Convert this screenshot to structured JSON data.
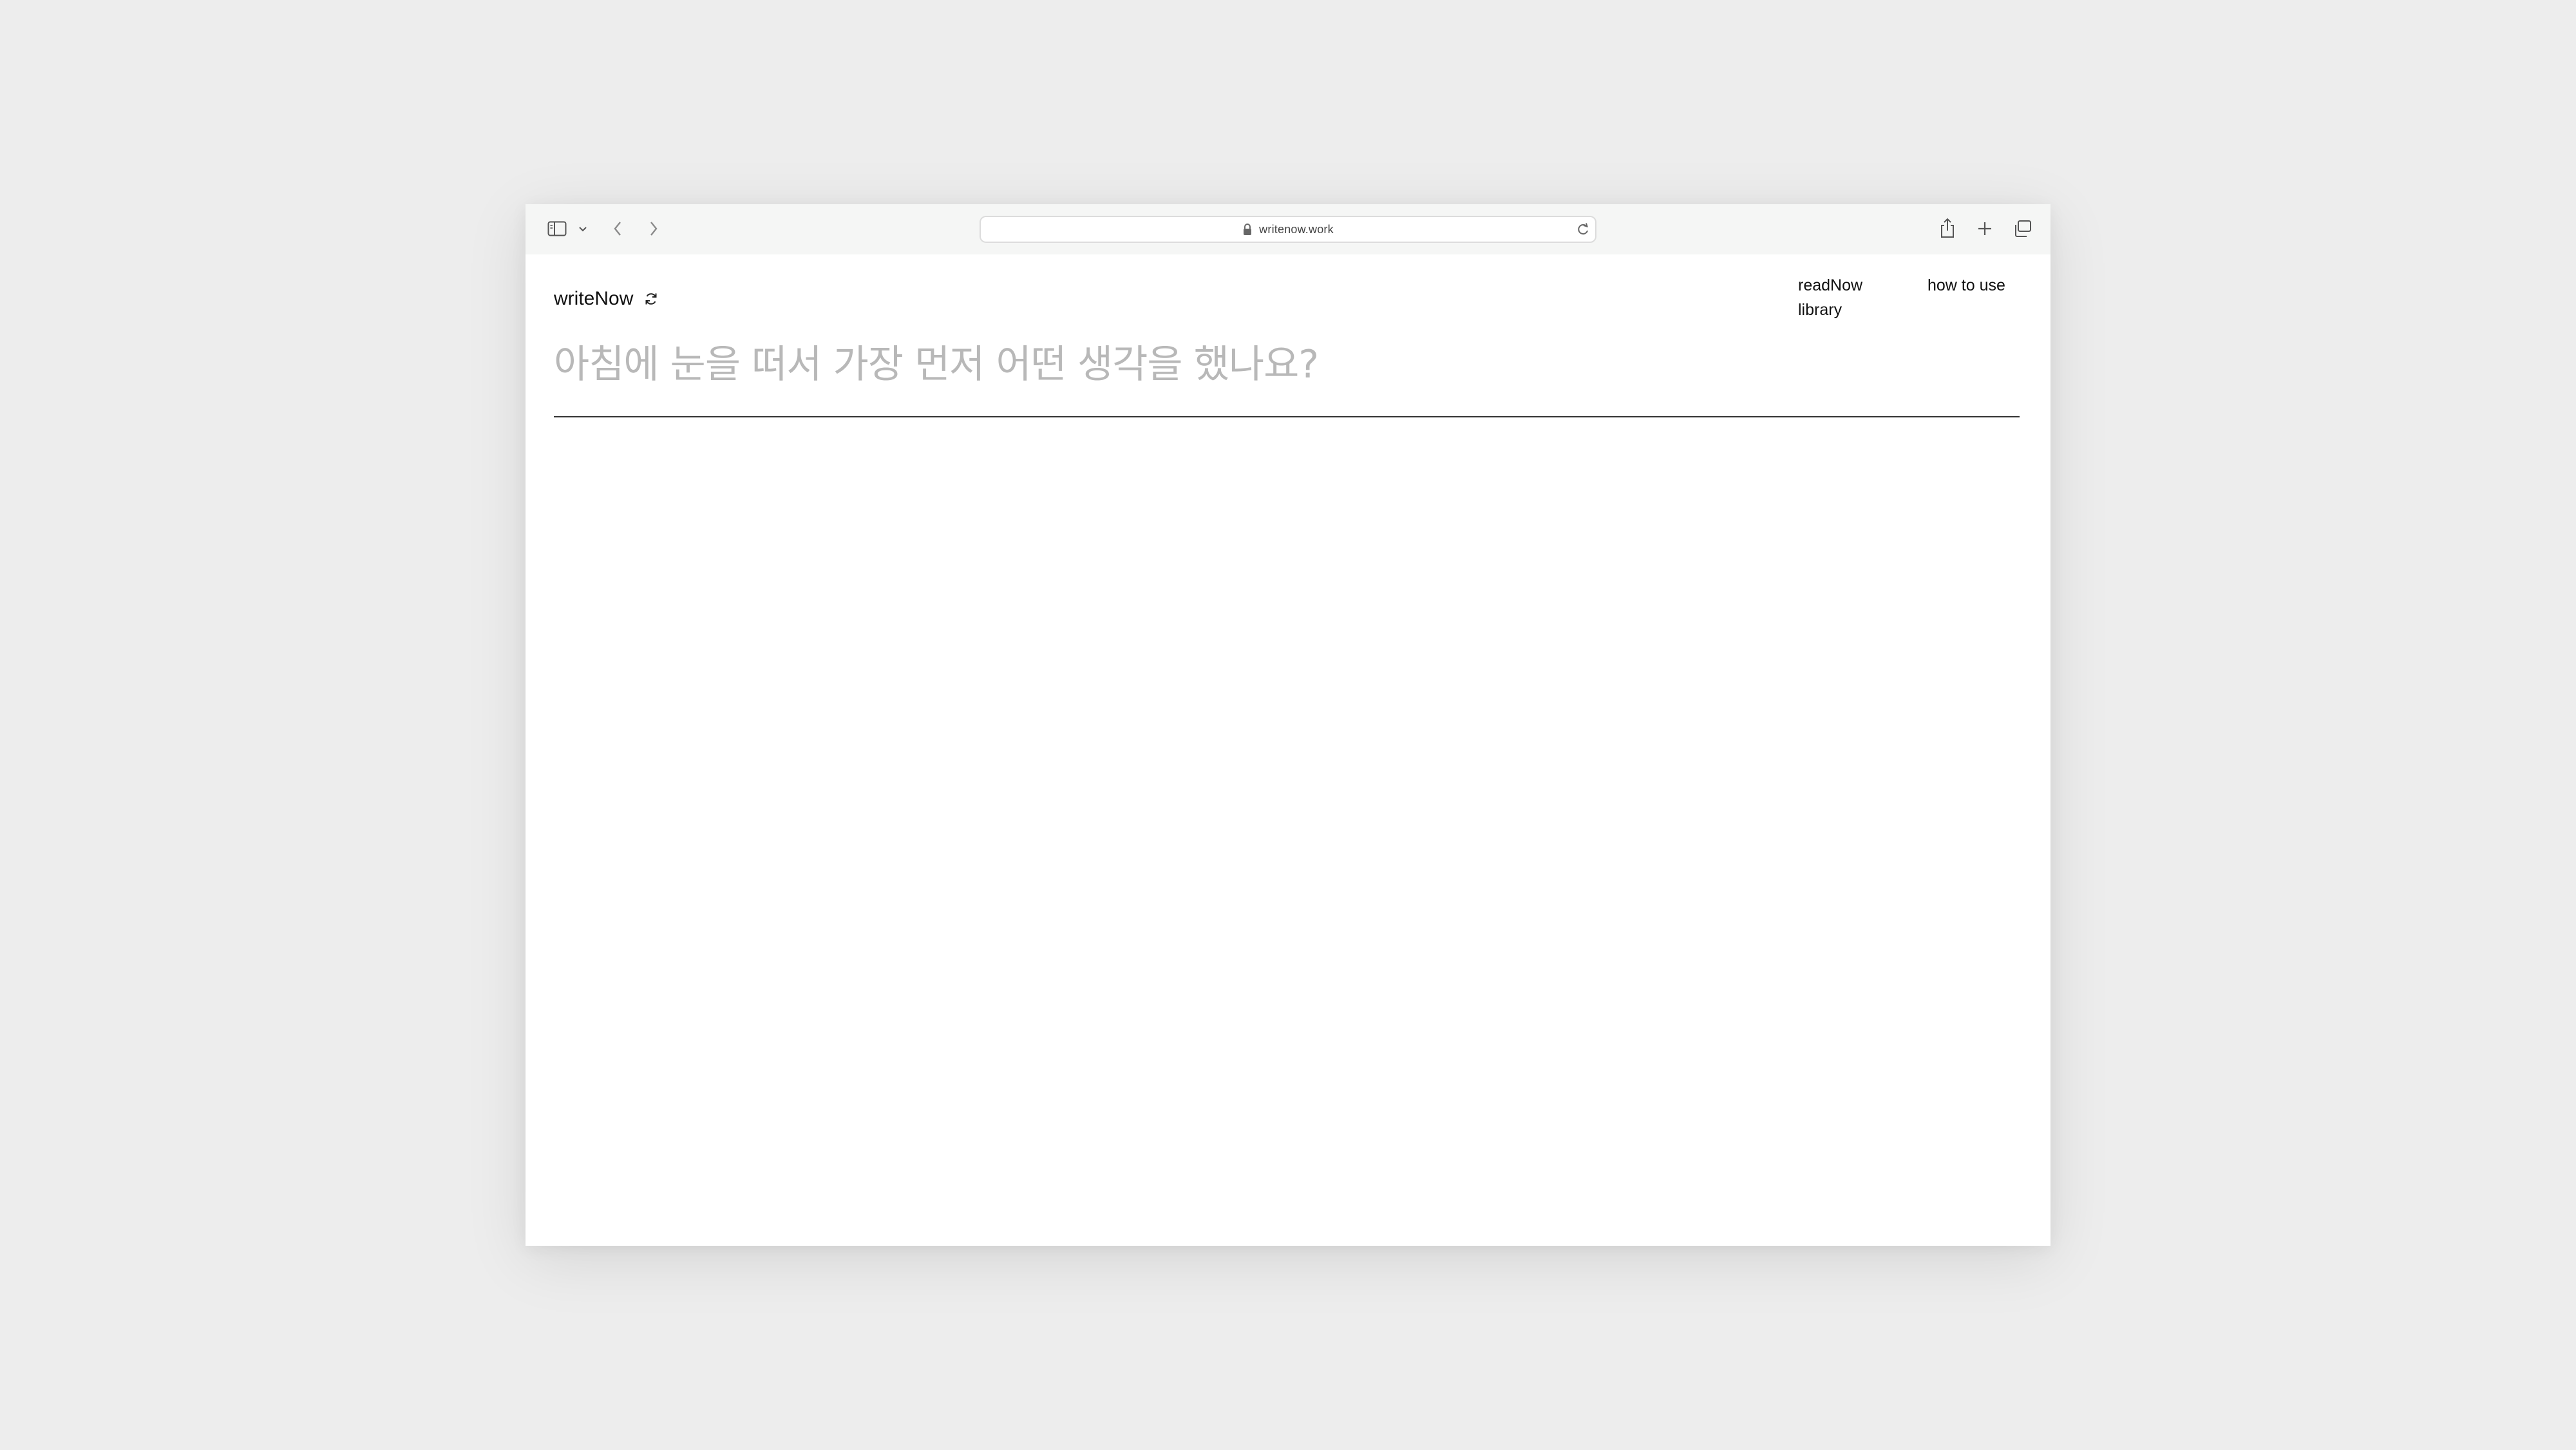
{
  "browser": {
    "url": "writenow.work",
    "icons": {
      "sidebar": "sidebar-icon",
      "sidebar_menu": "chevron-down-icon",
      "back": "chevron-left-icon",
      "forward": "chevron-right-icon",
      "lock": "lock-icon",
      "reload": "reload-icon",
      "share": "share-icon",
      "new_tab": "plus-icon",
      "tabs": "tabs-overview-icon"
    }
  },
  "app": {
    "brand": "writeNow",
    "brand_icon": "refresh-icon",
    "nav": {
      "read_now": "readNow",
      "library": "library",
      "how_to_use": "how to use"
    },
    "prompt": "아침에 눈을 떠서 가장 먼저 어떤 생각을 했나요?"
  },
  "colors": {
    "page_background": "#ededed",
    "toolbar_background": "#f5f6f5",
    "prompt_text": "#b8b8b8",
    "divider": "#333333"
  }
}
